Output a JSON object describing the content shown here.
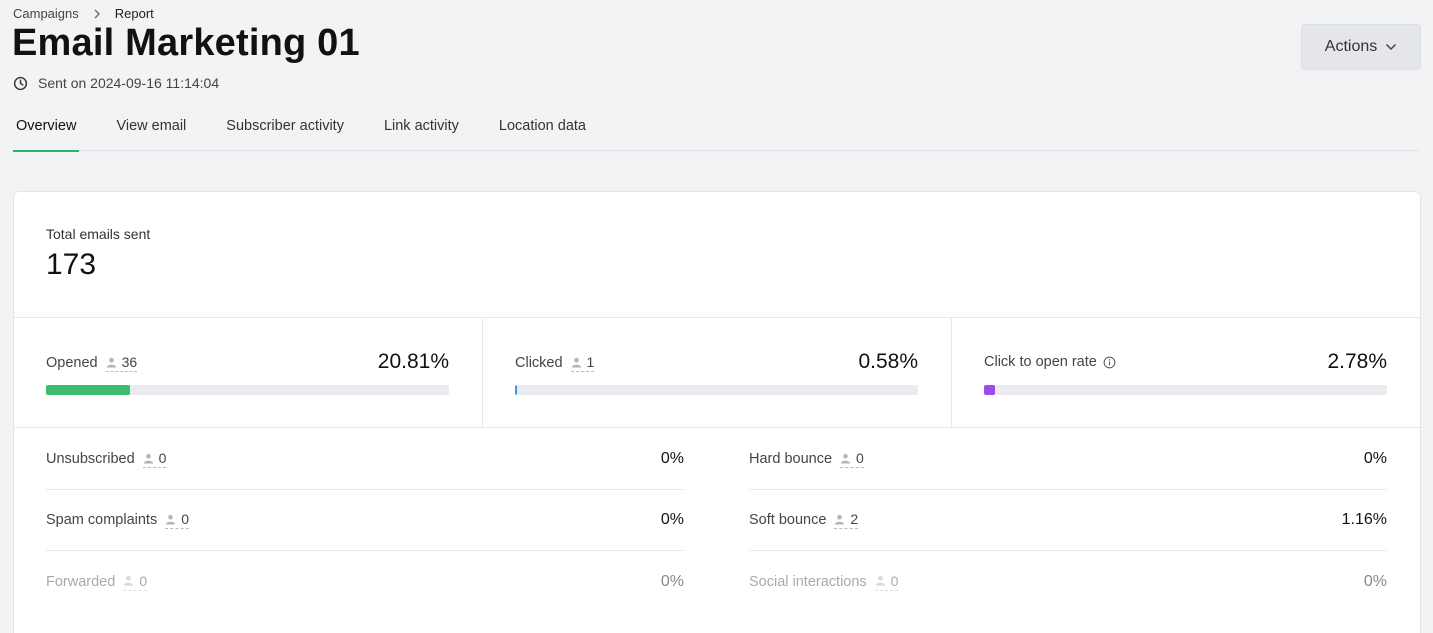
{
  "breadcrumb": {
    "parent": "Campaigns",
    "current": "Report"
  },
  "header": {
    "title": "Email Marketing 01",
    "sent_text": "Sent on 2024-09-16 11:14:04",
    "actions_label": "Actions"
  },
  "tabs": [
    {
      "label": "Overview",
      "active": true
    },
    {
      "label": "View email"
    },
    {
      "label": "Subscriber activity"
    },
    {
      "label": "Link activity"
    },
    {
      "label": "Location data"
    }
  ],
  "total": {
    "label": "Total emails sent",
    "value": "173"
  },
  "metrics": {
    "opened": {
      "label": "Opened",
      "count": "36",
      "percent": "20.81%",
      "fraction": 0.2081,
      "color": "#3cbd6b"
    },
    "clicked": {
      "label": "Clicked",
      "count": "1",
      "percent": "0.58%",
      "fraction": 0.0058,
      "color": "#4a90d9"
    },
    "cto": {
      "label": "Click to open rate",
      "percent": "2.78%",
      "fraction": 0.0278,
      "color": "#9b4be8"
    }
  },
  "stats_left": [
    {
      "label": "Unsubscribed",
      "count": "0",
      "percent": "0%"
    },
    {
      "label": "Spam complaints",
      "count": "0",
      "percent": "0%"
    },
    {
      "label": "Forwarded",
      "count": "0",
      "percent": "0%",
      "muted": true
    }
  ],
  "stats_right": [
    {
      "label": "Hard bounce",
      "count": "0",
      "percent": "0%"
    },
    {
      "label": "Soft bounce",
      "count": "2",
      "percent": "1.16%"
    },
    {
      "label": "Social interactions",
      "count": "0",
      "percent": "0%",
      "muted": true
    }
  ],
  "icons": {
    "breadcrumb_separator": "chevron-right-icon",
    "sent": "clock-icon",
    "actions": "chevron-down-icon",
    "count": "person-icon",
    "info": "info-icon"
  }
}
